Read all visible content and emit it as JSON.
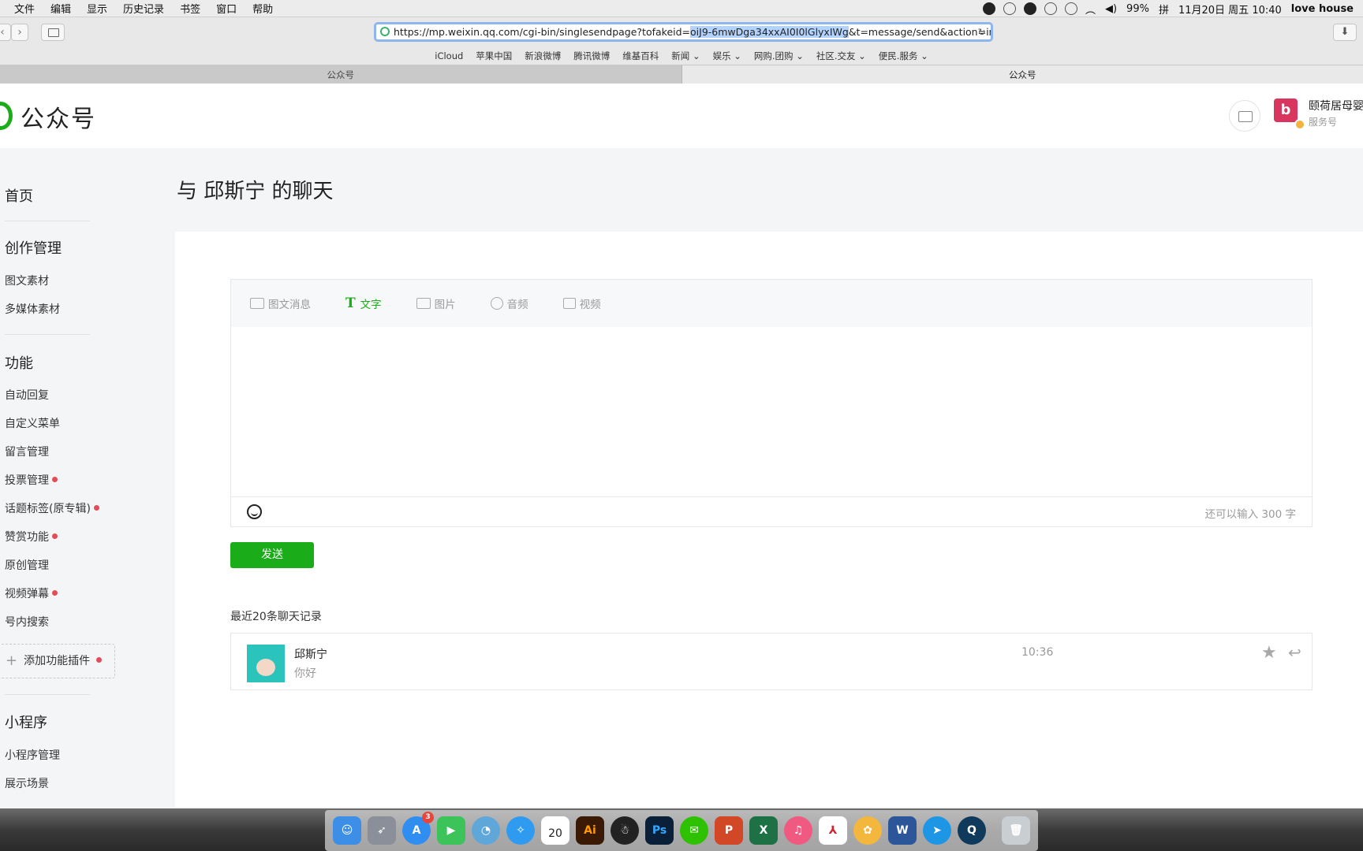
{
  "menubar": {
    "menus": [
      "文件",
      "编辑",
      "显示",
      "历史记录",
      "书签",
      "窗口",
      "帮助"
    ],
    "battery": "99%",
    "datetime": "11月20日 周五  10:40",
    "user": "love house"
  },
  "browser": {
    "url_pre": "https://mp.weixin.qq.com/cgi-bin/singlesendpage?tofakeid=",
    "url_sel": "oiJ9-6mwDga34xxAI0I0lGlyxIWg",
    "url_post": "&t=message/send&action=index&",
    "bookmarks": [
      "iCloud",
      "苹果中国",
      "新浪微博",
      "腾讯微博",
      "维基百科",
      "新闻 ⌄",
      "娱乐 ⌄",
      "网购.团购 ⌄",
      "社区.交友 ⌄",
      "便民.服务 ⌄"
    ],
    "tabs": [
      "公众号",
      "公众号"
    ]
  },
  "header": {
    "brand": "公众号",
    "account_name": "颐荷居母婴",
    "account_type": "服务号"
  },
  "sidebar": {
    "home": "首页",
    "create_heading": "创作管理",
    "create_items": [
      "图文素材",
      "多媒体素材"
    ],
    "func_heading": "功能",
    "func_items": [
      "自动回复",
      "自定义菜单",
      "留言管理",
      "投票管理",
      "话题标签(原专辑)",
      "赞赏功能",
      "原创管理",
      "视频弹幕",
      "号内搜索"
    ],
    "add_plugin": "添加功能插件",
    "mini_heading": "小程序",
    "mini_items": [
      "小程序管理",
      "展示场景"
    ]
  },
  "main": {
    "title": "与 邱斯宁 的聊天",
    "editor_tabs": [
      "图文消息",
      "文字",
      "图片",
      "音频",
      "视频"
    ],
    "counter": "还可以输入 300 字",
    "send": "发送",
    "history_title": "最近20条聊天记录",
    "message": {
      "name": "邱斯宁",
      "text": "你好",
      "time": "10:36"
    }
  },
  "dock": {
    "appstore_badge": "3",
    "calendar_day": "20",
    "calendar_month": "11月"
  },
  "colors": {
    "accent": "#1aad19",
    "dot": "#e34d59"
  }
}
